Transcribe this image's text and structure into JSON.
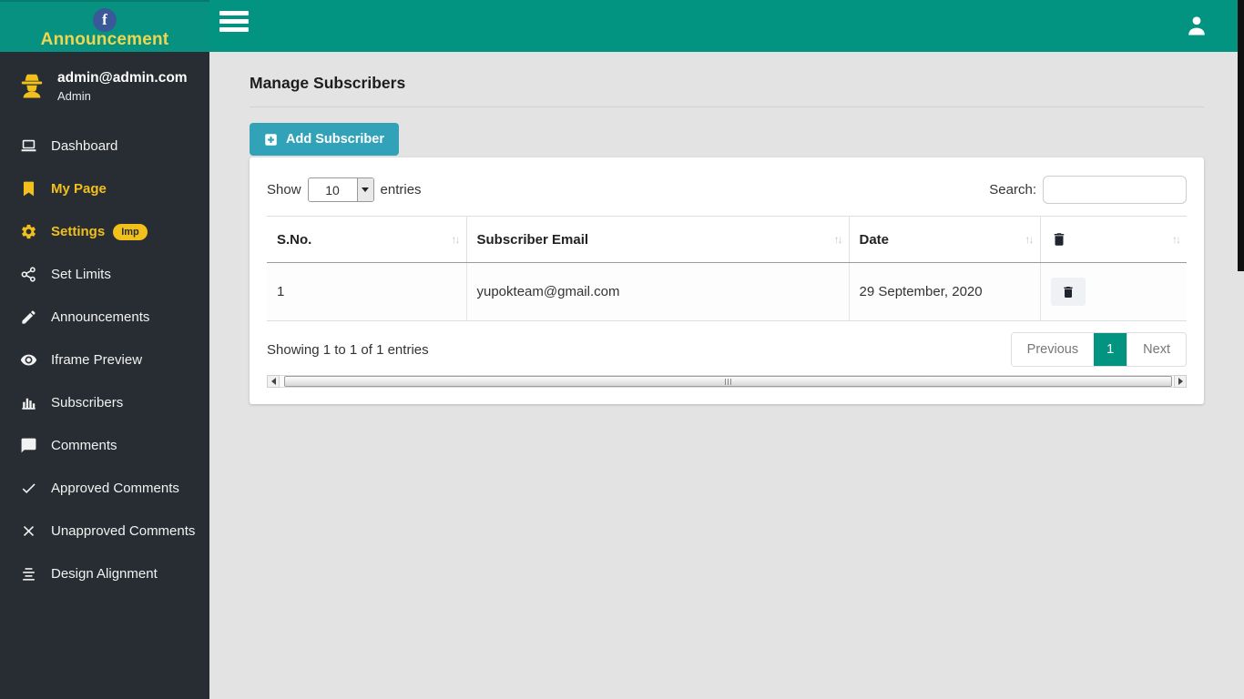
{
  "colors": {
    "teal": "#029481",
    "sidebar_bg": "#272d32",
    "accent_yellow": "#f2c01c",
    "logo_yellow": "#eed74f",
    "facebook_blue": "#3a5998",
    "add_button_cyan": "#32a2b8"
  },
  "logo": {
    "title": "Announcement",
    "icon": "facebook-icon",
    "fb_letter": "f"
  },
  "topbar": {
    "menu_icon": "hamburger-icon",
    "user_icon": "person-icon"
  },
  "sidebar": {
    "user": {
      "email": "admin@admin.com",
      "role": "Admin",
      "icon": "spy-icon"
    },
    "items": [
      {
        "label": "Dashboard",
        "icon": "laptop-icon"
      },
      {
        "label": "My Page",
        "icon": "bookmark-icon"
      },
      {
        "label": "Settings",
        "icon": "gear-icon",
        "badge": "Imp"
      },
      {
        "label": "Set Limits",
        "icon": "nodes-icon"
      },
      {
        "label": "Announcements",
        "icon": "pencil-icon"
      },
      {
        "label": "Iframe Preview",
        "icon": "eye-icon"
      },
      {
        "label": "Subscribers",
        "icon": "bar-chart-icon"
      },
      {
        "label": "Comments",
        "icon": "comment-icon"
      },
      {
        "label": "Approved Comments",
        "icon": "check-icon"
      },
      {
        "label": "Unapproved Comments",
        "icon": "x-icon"
      },
      {
        "label": "Design Alignment",
        "icon": "align-icon"
      }
    ]
  },
  "main": {
    "title": "Manage Subscribers",
    "add_button": {
      "label": "Add Subscriber",
      "icon": "plus-square-icon"
    },
    "controls": {
      "show_label": "Show",
      "page_length": "10",
      "entries_label": "entries",
      "search_label": "Search:",
      "search_value": ""
    },
    "table": {
      "sort_glyph": "↑↓",
      "headers": {
        "sno": "S.No.",
        "email": "Subscriber Email",
        "date": "Date",
        "delete_icon": "trash-icon"
      },
      "rows": [
        {
          "sno": "1",
          "email": "yupokteam@gmail.com",
          "date": "29 September, 2020"
        }
      ]
    },
    "footer": {
      "info": "Showing 1 to 1 of 1 entries",
      "pagination": {
        "previous": "Previous",
        "current": "1",
        "next": "Next"
      }
    }
  }
}
